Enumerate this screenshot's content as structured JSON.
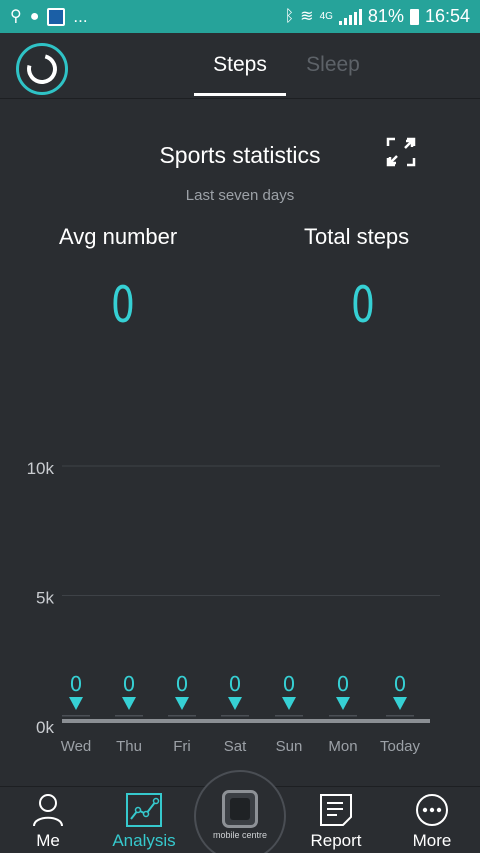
{
  "status_bar": {
    "battery": "81%",
    "time": "16:54",
    "network": "4G",
    "dots": "..."
  },
  "header": {
    "tabs": [
      {
        "label": "Steps",
        "active": true
      },
      {
        "label": "Sleep",
        "active": false
      }
    ]
  },
  "stats": {
    "title": "Sports statistics",
    "subtitle": "Last seven days",
    "avg_label": "Avg number",
    "total_label": "Total steps",
    "avg_value": "0",
    "total_value": "0"
  },
  "chart_data": {
    "type": "bar",
    "categories": [
      "Wed",
      "Thu",
      "Fri",
      "Sat",
      "Sun",
      "Mon",
      "Today"
    ],
    "values": [
      0,
      0,
      0,
      0,
      0,
      0,
      0
    ],
    "data_labels": [
      "0",
      "0",
      "0",
      "0",
      "0",
      "0",
      "0"
    ],
    "y_ticks": [
      "0k",
      "5k",
      "10k"
    ],
    "ylim": [
      0,
      10000
    ],
    "grid": true,
    "accent": "#36d0d4"
  },
  "nav": {
    "items": [
      {
        "label": "Me",
        "icon": "person-icon"
      },
      {
        "label": "Analysis",
        "icon": "analysis-chart-icon",
        "active": true
      },
      {
        "label": "Report",
        "icon": "report-icon"
      },
      {
        "label": "More",
        "icon": "more-dots-icon"
      }
    ],
    "center_icon": "watch-icon",
    "watermark": "mobile centre"
  },
  "colors": {
    "accent": "#36d0d4",
    "status_bar": "#26a39a",
    "background": "#2a2d31"
  }
}
